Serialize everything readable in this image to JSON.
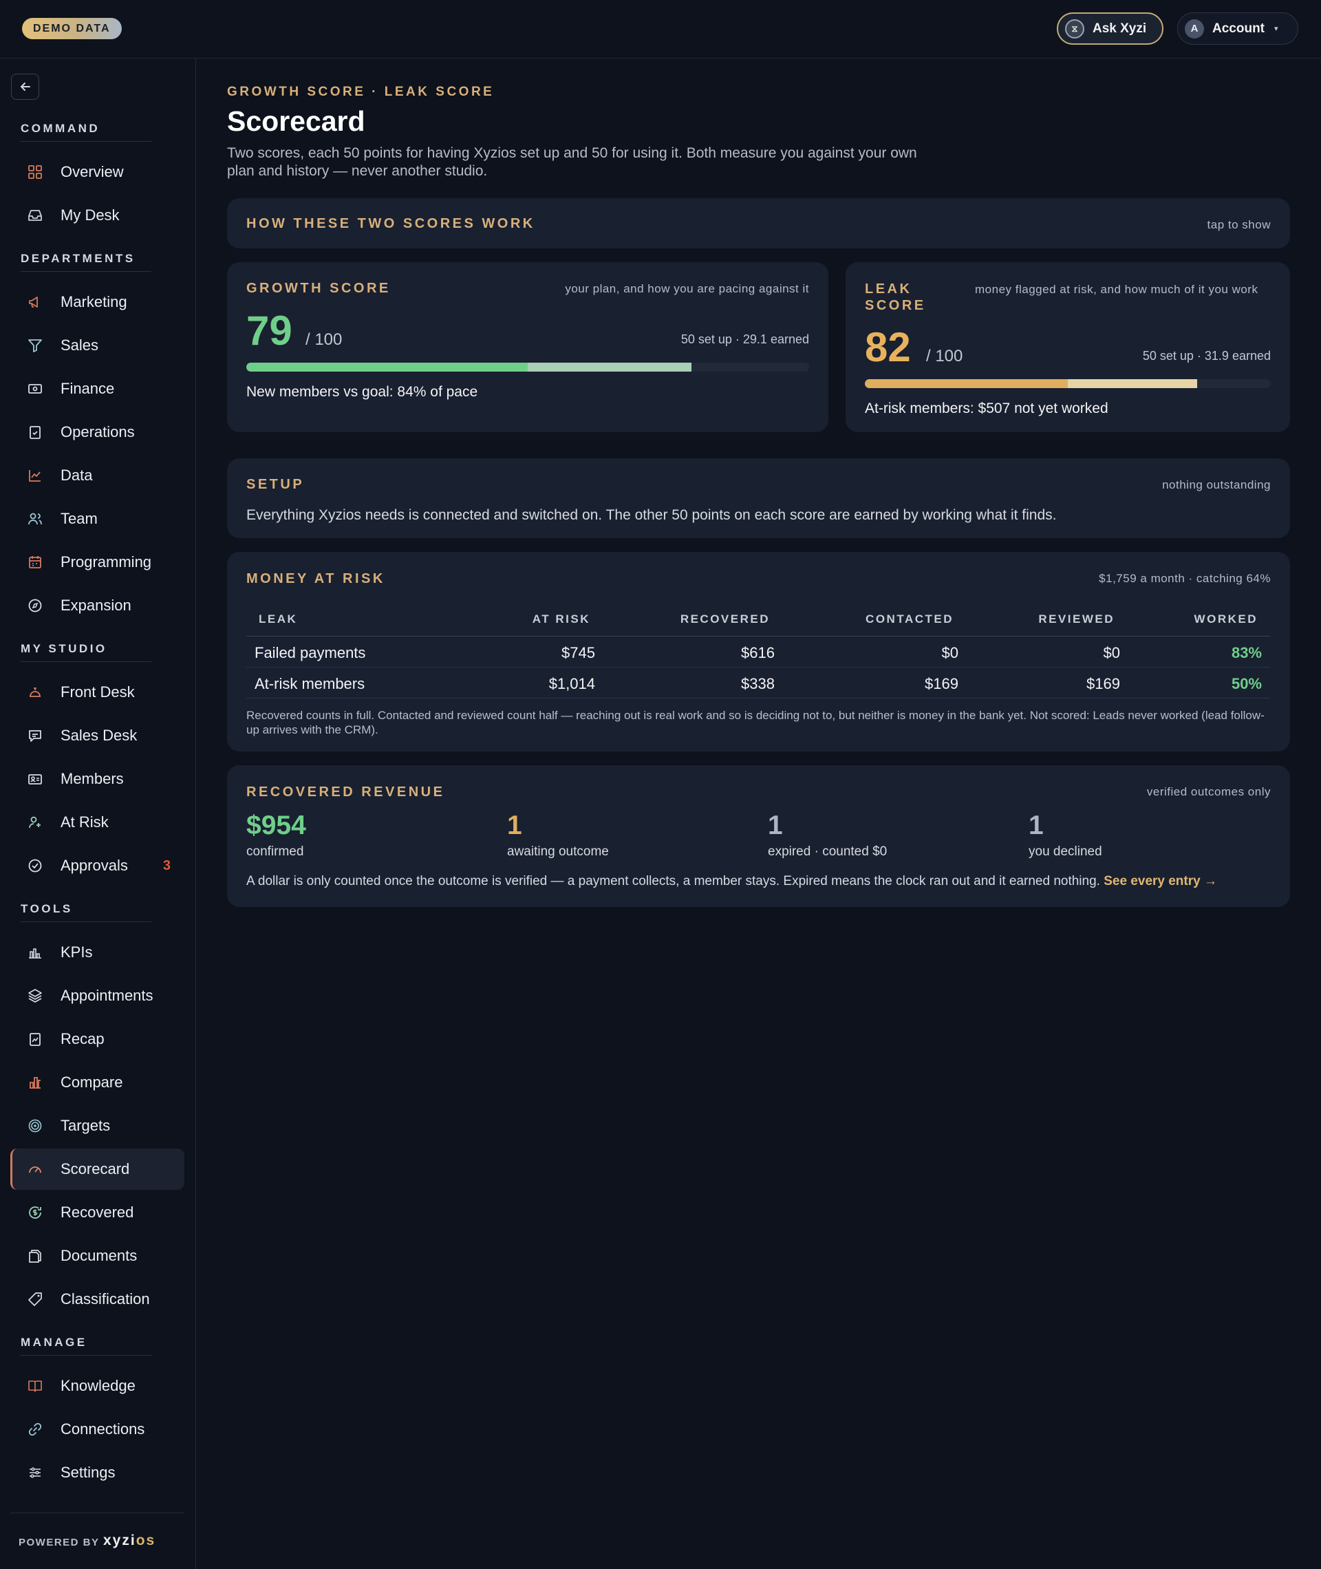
{
  "topbar": {
    "demo_badge": "DEMO DATA",
    "ask_label": "Ask Xyzi",
    "ask_icon_glyph": "⧖",
    "account_label": "Account",
    "account_initial": "A",
    "account_caret": "▾"
  },
  "sidebar": {
    "collapse_icon": "arrow-left-icon",
    "sections": {
      "command": "COMMAND",
      "departments": "DEPARTMENTS",
      "my_studio": "MY STUDIO",
      "tools": "TOOLS",
      "manage": "MANAGE"
    },
    "items": {
      "overview": "Overview",
      "my_desk": "My Desk",
      "marketing": "Marketing",
      "sales": "Sales",
      "finance": "Finance",
      "operations": "Operations",
      "data": "Data",
      "team": "Team",
      "programming": "Programming",
      "expansion": "Expansion",
      "front_desk": "Front Desk",
      "sales_desk": "Sales Desk",
      "members": "Members",
      "at_risk": "At Risk",
      "approvals": "Approvals",
      "kpis": "KPIs",
      "appointments": "Appointments",
      "recap": "Recap",
      "compare": "Compare",
      "targets": "Targets",
      "scorecard": "Scorecard",
      "recovered": "Recovered",
      "documents": "Documents",
      "classification": "Classification",
      "knowledge": "Knowledge",
      "connections": "Connections",
      "settings": "Settings"
    },
    "approvals_badge": "3",
    "powered_by": "POWERED BY",
    "brand_main": "xyzi",
    "brand_accent": "os"
  },
  "page": {
    "eyebrow": "GROWTH SCORE · LEAK SCORE",
    "title": "Scorecard",
    "subtitle": "Two scores, each 50 points for having Xyzios set up and 50 for using it. Both measure you against your own plan and history — never another studio."
  },
  "how": {
    "title": "HOW THESE TWO SCORES WORK",
    "action": "tap to show"
  },
  "growth": {
    "title": "GROWTH SCORE",
    "note": "your plan, and how you are pacing against it",
    "score": "79",
    "out_of": "/ 100",
    "earned": "50 set up · 29.1 earned",
    "pace": "New members vs goal: 84% of pace",
    "setup_fraction": 0.5,
    "earned_fraction": 0.291,
    "color_setup": "#6fcf8a",
    "color_earned": "#a9cfb6"
  },
  "leak": {
    "title": "LEAK SCORE",
    "note": "money flagged at risk, and how much of it you work",
    "score": "82",
    "out_of": "/ 100",
    "earned": "50 set up · 31.9 earned",
    "pace": "At-risk members: $507 not yet worked",
    "setup_fraction": 0.5,
    "earned_fraction": 0.319,
    "color_setup": "#e0ae5e",
    "color_earned": "#e6d5a6"
  },
  "setup": {
    "title": "SETUP",
    "note": "nothing outstanding",
    "body": "Everything Xyzios needs is connected and switched on. The other 50 points on each score are earned by working what it finds."
  },
  "money": {
    "title": "MONEY AT RISK",
    "note": "$1,759 a month · catching 64%",
    "columns": [
      "LEAK",
      "AT RISK",
      "RECOVERED",
      "CONTACTED",
      "REVIEWED",
      "WORKED"
    ],
    "rows": [
      [
        "Failed payments",
        "$745",
        "$616",
        "$0",
        "$0",
        "83%"
      ],
      [
        "At-risk members",
        "$1,014",
        "$338",
        "$169",
        "$169",
        "50%"
      ]
    ],
    "footnote": "Recovered counts in full. Contacted and reviewed count half — reaching out is real work and so is deciding not to, but neither is money in the bank yet. Not scored: Leads never worked (lead follow-up arrives with the CRM)."
  },
  "recovered": {
    "title": "RECOVERED REVENUE",
    "note": "verified outcomes only",
    "stats": [
      {
        "value": "$954",
        "label": "confirmed"
      },
      {
        "value": "1",
        "label": "awaiting outcome"
      },
      {
        "value": "1",
        "label": "expired · counted $0"
      },
      {
        "value": "1",
        "label": "you declined"
      }
    ],
    "body": "A dollar is only counted once the outcome is verified — a payment collects, a member stays. Expired means the clock ran out and it earned nothing.",
    "link": "See every entry →"
  },
  "colors": {
    "accent_gold": "#d9b07a",
    "positive_green": "#6fcf8a",
    "score_gold": "#e8b25c",
    "badge_red": "#e05a3a"
  }
}
